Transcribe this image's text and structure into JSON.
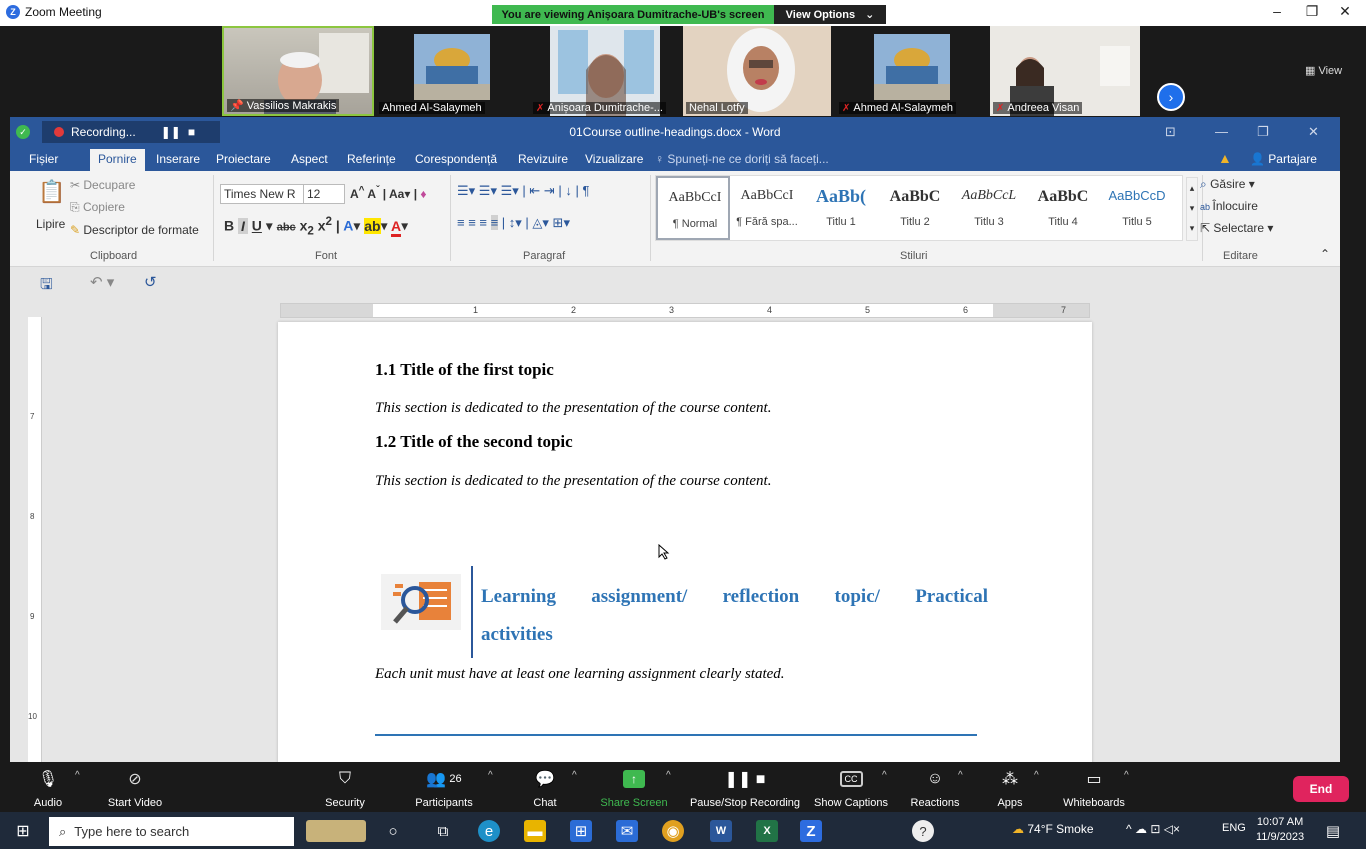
{
  "zoom": {
    "window_title": "Zoom Meeting",
    "viewing_banner": "You are viewing Anișoara Dumitrache-UB's screen",
    "view_options": "View Options",
    "view_label": "View",
    "participants_tiles": [
      {
        "name": "Vassilios Makrakis",
        "muted": false,
        "pinned": true
      },
      {
        "name": "Ahmed Al-Salaymeh",
        "muted": false
      },
      {
        "name": "Anișoara Dumitrache-...",
        "muted": true
      },
      {
        "name": "Nehal Lotfy",
        "muted": false
      },
      {
        "name": "Ahmed Al-Salaymeh",
        "muted": true
      },
      {
        "name": "Andreea Visan",
        "muted": true
      }
    ],
    "toolbar": {
      "audio": "Audio",
      "start_video": "Start Video",
      "security": "Security",
      "participants": "Participants",
      "participants_count": "26",
      "chat": "Chat",
      "share_screen": "Share Screen",
      "pause_stop_recording": "Pause/Stop Recording",
      "show_captions": "Show Captions",
      "reactions": "Reactions",
      "apps": "Apps",
      "whiteboards": "Whiteboards",
      "end": "End"
    }
  },
  "word": {
    "recording": "Recording...",
    "doc_title": "01Course outline-headings.docx - Word",
    "tabs": [
      "Fișier",
      "Pornire",
      "Inserare",
      "Proiectare",
      "Aspect",
      "Referințe",
      "Corespondență",
      "Revizuire",
      "Vizualizare"
    ],
    "tell_me": "Spuneți-ne ce doriți să faceți...",
    "share": "Partajare",
    "clipboard": {
      "paste": "Lipire",
      "cut": "Decupare",
      "copy": "Copiere",
      "format_painter": "Descriptor de formate",
      "label": "Clipboard"
    },
    "font": {
      "name": "Times New R",
      "size": "12",
      "label": "Font"
    },
    "paragraph_label": "Paragraf",
    "styles": [
      {
        "sample": "AaBbCcI",
        "name": "¶ Normal"
      },
      {
        "sample": "AaBbCcI",
        "name": "¶ Fără spa..."
      },
      {
        "sample": "AaBb(",
        "name": "Titlu 1"
      },
      {
        "sample": "AaBbC",
        "name": "Titlu 2"
      },
      {
        "sample": "AaBbCcL",
        "name": "Titlu 3"
      },
      {
        "sample": "AaBbC",
        "name": "Titlu 4"
      },
      {
        "sample": "AaBbCcD",
        "name": "Titlu 5"
      }
    ],
    "styles_label": "Stiluri",
    "editing": {
      "find": "Găsire",
      "replace": "Înlocuire",
      "select": "Selectare",
      "label": "Editare"
    },
    "document": {
      "heading1": "1.1 Title of the first topic",
      "para1": "This section is dedicated to the presentation of the course content.",
      "heading2": "1.2 Title of the second topic",
      "para2": "This section is dedicated to the presentation of the course content.",
      "assignment_line1": "Learning assignment/ reflection topic/ Practical",
      "assignment_line2": "activities",
      "assignment_text": "Each unit must have at least one learning assignment clearly stated."
    }
  },
  "taskbar": {
    "search_placeholder": "Type here to search",
    "weather": "74°F Smoke",
    "language": "ENG",
    "time": "10:07 AM",
    "date": "11/9/2023"
  }
}
